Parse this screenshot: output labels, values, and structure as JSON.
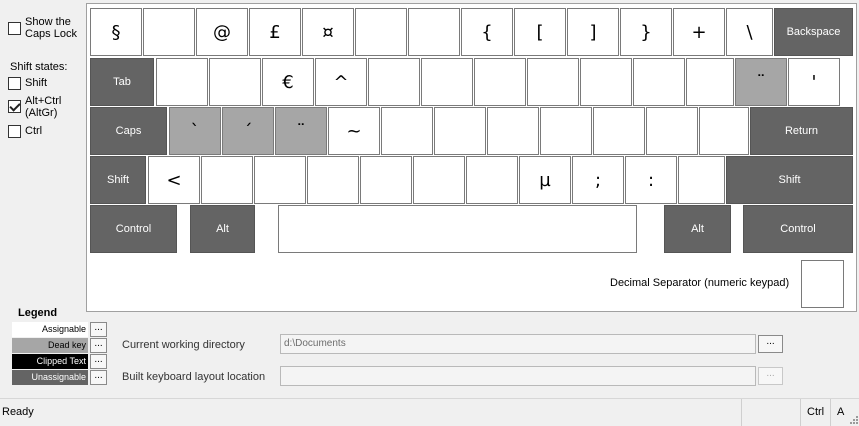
{
  "left_panel": {
    "show_caps_lock": {
      "label_line1": "Show the",
      "label_line2": "Caps Lock",
      "checked": false
    },
    "shift_states_label": "Shift states:",
    "shift": {
      "label": "Shift",
      "checked": false
    },
    "altgr": {
      "label_line1": "Alt+Ctrl",
      "label_line2": "(AltGr)",
      "checked": true
    },
    "ctrl": {
      "label": "Ctrl",
      "checked": false
    }
  },
  "keyboard": {
    "row1": [
      "§",
      "",
      "@",
      "£",
      "¤",
      "",
      "",
      "{",
      "[",
      "]",
      "}",
      "+",
      "\\"
    ],
    "backspace": "Backspace",
    "tab": "Tab",
    "row2": [
      "",
      "",
      "€",
      "^",
      "",
      "",
      "",
      "",
      "",
      "",
      "",
      "¨",
      "'"
    ],
    "caps": "Caps",
    "row3": [
      "`",
      "´",
      "¨",
      "~",
      "",
      "",
      "",
      "",
      "",
      "",
      ""
    ],
    "return": "Return",
    "shift_left": "Shift",
    "row4": [
      "<",
      "",
      "",
      "",
      "",
      "",
      "",
      "µ",
      ";",
      ":",
      ""
    ],
    "shift_right": "Shift",
    "control_left": "Control",
    "alt_left": "Alt",
    "space": "",
    "alt_right": "Alt",
    "control_right": "Control",
    "decimal_separator_label": "Decimal Separator (numeric keypad)",
    "decimal_separator_value": ""
  },
  "legend": {
    "title": "Legend",
    "items": [
      {
        "label": "Assignable",
        "button": "..."
      },
      {
        "label": "Dead key",
        "button": "..."
      },
      {
        "label": "Clipped Text",
        "button": "..."
      },
      {
        "label": "Unassignable",
        "button": "..."
      }
    ]
  },
  "paths": {
    "cwd_label": "Current working directory",
    "cwd_value": "d:\\Documents",
    "cwd_button": "...",
    "build_label": "Built keyboard layout location",
    "build_value": "",
    "build_button": "..."
  },
  "status": {
    "text": "Ready",
    "ctrl": "Ctrl",
    "a": "A"
  },
  "colors": {
    "assignable": "#ffffff",
    "dead_key": "#a6a6a6",
    "clipped_text": "#000000",
    "unassignable": "#646464"
  }
}
